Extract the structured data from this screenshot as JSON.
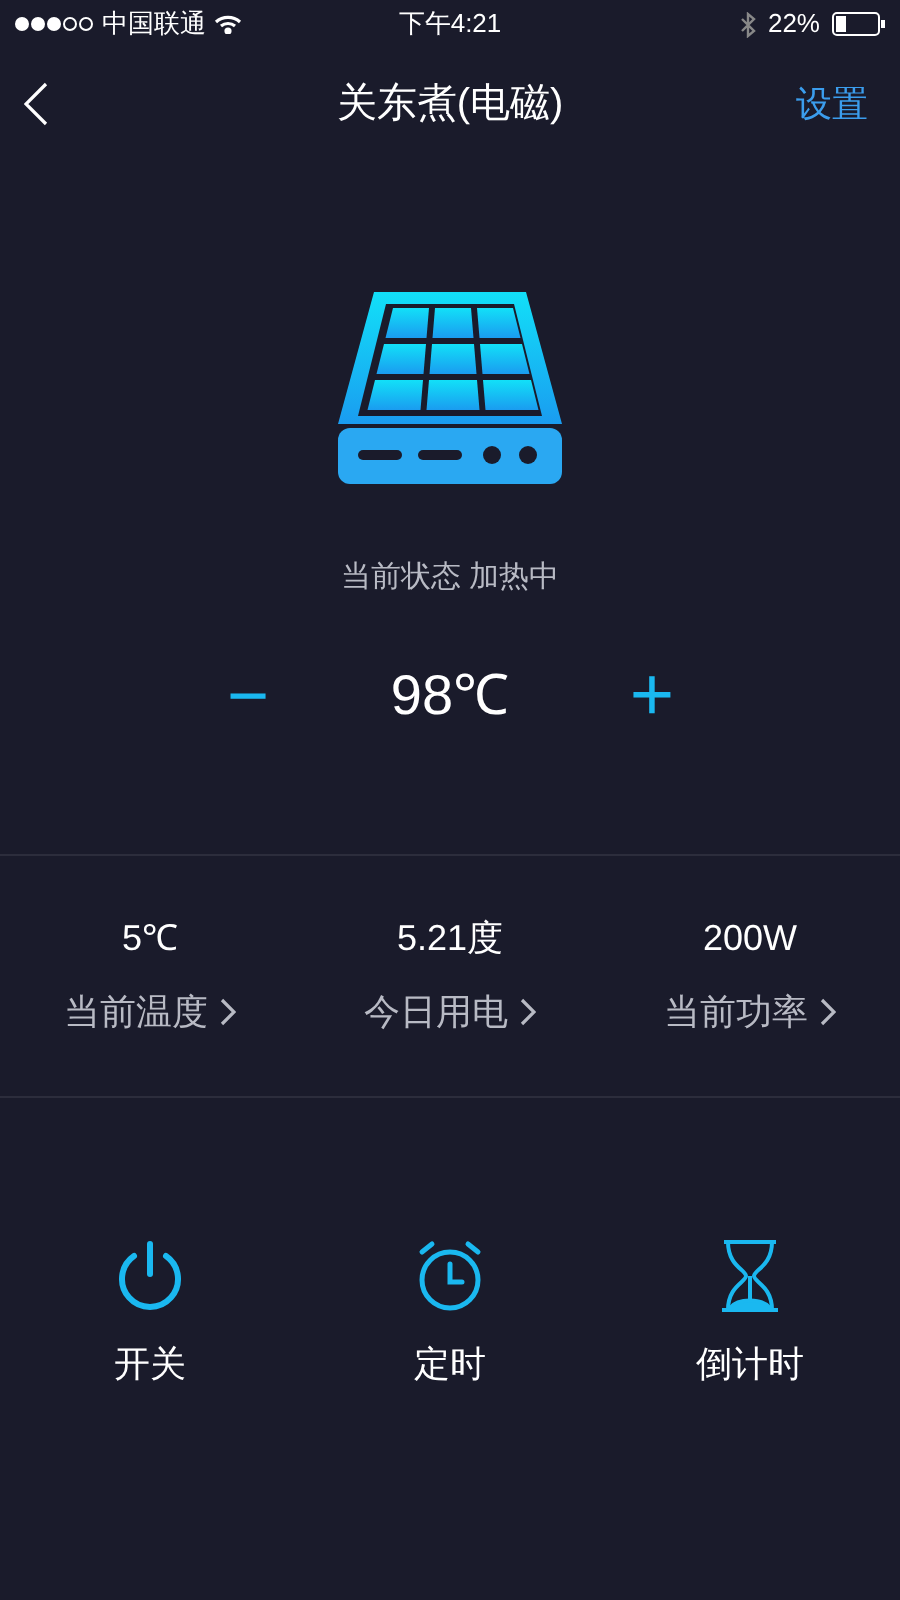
{
  "status_bar": {
    "carrier": "中国联通",
    "time": "下午4:21",
    "battery": "22%"
  },
  "nav": {
    "title": "关东煮(电磁)",
    "action": "设置"
  },
  "device": {
    "status": "当前状态 加热中",
    "minus": "−",
    "temperature": "98℃",
    "plus": "+"
  },
  "stats": [
    {
      "value": "5℃",
      "label": "当前温度"
    },
    {
      "value": "5.21度",
      "label": "今日用电"
    },
    {
      "value": "200W",
      "label": "当前功率"
    }
  ],
  "actions": [
    {
      "kind": "power",
      "label": "开关"
    },
    {
      "kind": "alarm",
      "label": "定时"
    },
    {
      "kind": "hourglass",
      "label": "倒计时"
    }
  ]
}
